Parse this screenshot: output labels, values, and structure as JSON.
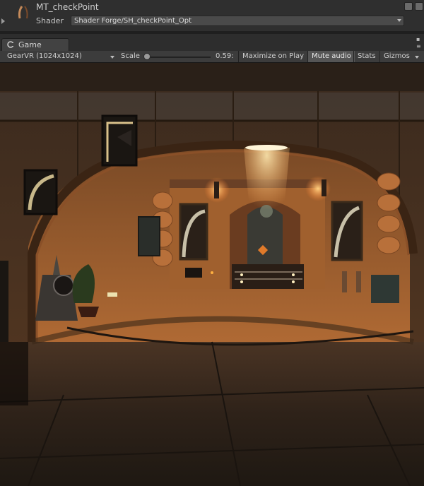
{
  "material": {
    "name": "MT_checkPoint",
    "shader_label": "Shader",
    "shader_value": "Shader Forge/SH_checkPoint_Opt"
  },
  "game_window": {
    "tab_label": "Game",
    "controls": [
      "▪",
      "≡"
    ]
  },
  "toolbar": {
    "resolution": "GearVR (1024x1024)",
    "scale_label": "Scale",
    "scale_value": "0.59:",
    "buttons": [
      {
        "label": "Maximize on Play",
        "active": false
      },
      {
        "label": "Mute audio",
        "active": true
      },
      {
        "label": "Stats",
        "active": false
      },
      {
        "label": "Gizmos",
        "active": false
      }
    ]
  },
  "scene": {
    "description_icons": [
      "material-sphere-icon",
      "game-tab-icon"
    ],
    "colors": {
      "wall": "#b06a34",
      "floor": "#3a2a1c",
      "light": "#ffe1a0",
      "accent": "#e07a2a"
    }
  }
}
